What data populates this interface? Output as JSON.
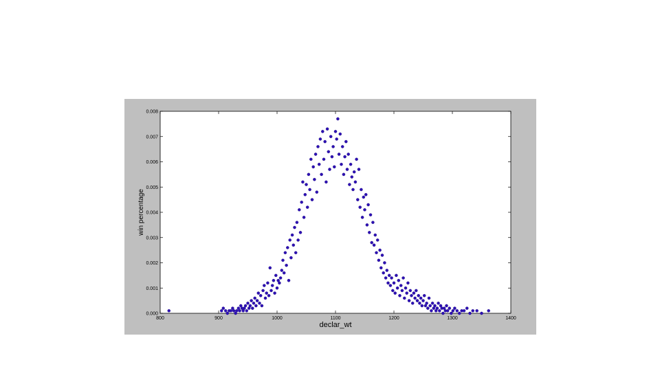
{
  "chart_data": {
    "type": "scatter",
    "title": "",
    "xlabel": "declar_wt",
    "ylabel": "win percentage",
    "xlim": [
      800,
      1400
    ],
    "ylim": [
      0,
      0.008
    ],
    "x_ticks": [
      "800",
      "900",
      "1000",
      "1100",
      "1200",
      "1300",
      "1400"
    ],
    "y_ticks": [
      "0.000",
      "0.001",
      "0.002",
      "0.003",
      "0.004",
      "0.005",
      "0.006",
      "0.007",
      "0.008"
    ],
    "grid": false,
    "legend": "none",
    "marker_color": "#2d10b4",
    "series": [
      {
        "points": [
          [
            815,
            0.0001
          ],
          [
            905,
            0.0001
          ],
          [
            908,
            0.0002
          ],
          [
            912,
            0.0001
          ],
          [
            915,
            0.0
          ],
          [
            918,
            0.0001
          ],
          [
            921,
            0.0001
          ],
          [
            924,
            0.0002
          ],
          [
            926,
            0.0001
          ],
          [
            929,
            0.0
          ],
          [
            931,
            0.0001
          ],
          [
            934,
            0.0002
          ],
          [
            936,
            0.0001
          ],
          [
            938,
            0.0003
          ],
          [
            940,
            0.0002
          ],
          [
            942,
            0.0001
          ],
          [
            944,
            0.0002
          ],
          [
            946,
            0.0003
          ],
          [
            948,
            0.0001
          ],
          [
            950,
            0.0004
          ],
          [
            952,
            0.0002
          ],
          [
            954,
            0.0003
          ],
          [
            956,
            0.0005
          ],
          [
            958,
            0.0002
          ],
          [
            960,
            0.0004
          ],
          [
            962,
            0.0006
          ],
          [
            964,
            0.0003
          ],
          [
            966,
            0.0005
          ],
          [
            968,
            0.0008
          ],
          [
            970,
            0.0004
          ],
          [
            972,
            0.0007
          ],
          [
            974,
            0.0003
          ],
          [
            976,
            0.0009
          ],
          [
            978,
            0.0011
          ],
          [
            980,
            0.0006
          ],
          [
            982,
            0.0008
          ],
          [
            984,
            0.0012
          ],
          [
            986,
            0.0007
          ],
          [
            988,
            0.0018
          ],
          [
            990,
            0.0009
          ],
          [
            992,
            0.0011
          ],
          [
            994,
            0.0013
          ],
          [
            996,
            0.0008
          ],
          [
            998,
            0.0015
          ],
          [
            1000,
            0.001
          ],
          [
            1002,
            0.0013
          ],
          [
            1004,
            0.0012
          ],
          [
            1006,
            0.0014
          ],
          [
            1008,
            0.0017
          ],
          [
            1010,
            0.0021
          ],
          [
            1012,
            0.0016
          ],
          [
            1014,
            0.0024
          ],
          [
            1016,
            0.0019
          ],
          [
            1018,
            0.0026
          ],
          [
            1020,
            0.0013
          ],
          [
            1022,
            0.0029
          ],
          [
            1024,
            0.0022
          ],
          [
            1026,
            0.0031
          ],
          [
            1028,
            0.0027
          ],
          [
            1030,
            0.0034
          ],
          [
            1032,
            0.0024
          ],
          [
            1034,
            0.0036
          ],
          [
            1036,
            0.0029
          ],
          [
            1038,
            0.0041
          ],
          [
            1040,
            0.0032
          ],
          [
            1042,
            0.0044
          ],
          [
            1044,
            0.0052
          ],
          [
            1046,
            0.0038
          ],
          [
            1048,
            0.0047
          ],
          [
            1050,
            0.0051
          ],
          [
            1052,
            0.0042
          ],
          [
            1054,
            0.0055
          ],
          [
            1056,
            0.0049
          ],
          [
            1058,
            0.0061
          ],
          [
            1060,
            0.0045
          ],
          [
            1062,
            0.0058
          ],
          [
            1064,
            0.0053
          ],
          [
            1066,
            0.0063
          ],
          [
            1068,
            0.0048
          ],
          [
            1070,
            0.0066
          ],
          [
            1072,
            0.0059
          ],
          [
            1074,
            0.0069
          ],
          [
            1076,
            0.0055
          ],
          [
            1078,
            0.0072
          ],
          [
            1080,
            0.0061
          ],
          [
            1082,
            0.0068
          ],
          [
            1084,
            0.0052
          ],
          [
            1086,
            0.0073
          ],
          [
            1088,
            0.0064
          ],
          [
            1090,
            0.0057
          ],
          [
            1092,
            0.007
          ],
          [
            1094,
            0.0062
          ],
          [
            1096,
            0.0066
          ],
          [
            1098,
            0.0058
          ],
          [
            1100,
            0.0072
          ],
          [
            1102,
            0.0069
          ],
          [
            1104,
            0.0077
          ],
          [
            1106,
            0.0063
          ],
          [
            1108,
            0.0071
          ],
          [
            1110,
            0.0059
          ],
          [
            1112,
            0.0066
          ],
          [
            1114,
            0.0055
          ],
          [
            1116,
            0.0062
          ],
          [
            1118,
            0.0068
          ],
          [
            1120,
            0.0057
          ],
          [
            1122,
            0.0063
          ],
          [
            1124,
            0.0051
          ],
          [
            1126,
            0.0059
          ],
          [
            1128,
            0.0054
          ],
          [
            1130,
            0.0049
          ],
          [
            1132,
            0.0056
          ],
          [
            1134,
            0.0052
          ],
          [
            1136,
            0.0061
          ],
          [
            1138,
            0.0045
          ],
          [
            1140,
            0.0057
          ],
          [
            1142,
            0.0042
          ],
          [
            1144,
            0.0049
          ],
          [
            1146,
            0.0038
          ],
          [
            1148,
            0.0046
          ],
          [
            1150,
            0.0041
          ],
          [
            1152,
            0.0047
          ],
          [
            1154,
            0.0035
          ],
          [
            1156,
            0.0043
          ],
          [
            1158,
            0.0032
          ],
          [
            1160,
            0.0039
          ],
          [
            1162,
            0.0028
          ],
          [
            1164,
            0.0036
          ],
          [
            1166,
            0.0027
          ],
          [
            1168,
            0.0031
          ],
          [
            1170,
            0.0024
          ],
          [
            1172,
            0.0029
          ],
          [
            1174,
            0.0021
          ],
          [
            1176,
            0.0025
          ],
          [
            1178,
            0.0018
          ],
          [
            1180,
            0.0023
          ],
          [
            1182,
            0.0016
          ],
          [
            1184,
            0.002
          ],
          [
            1186,
            0.0014
          ],
          [
            1188,
            0.0017
          ],
          [
            1190,
            0.0012
          ],
          [
            1192,
            0.0015
          ],
          [
            1194,
            0.0011
          ],
          [
            1196,
            0.0014
          ],
          [
            1198,
            0.0009
          ],
          [
            1200,
            0.0012
          ],
          [
            1202,
            0.0008
          ],
          [
            1204,
            0.0015
          ],
          [
            1206,
            0.001
          ],
          [
            1208,
            0.0013
          ],
          [
            1210,
            0.0007
          ],
          [
            1212,
            0.0011
          ],
          [
            1214,
            0.0009
          ],
          [
            1216,
            0.0014
          ],
          [
            1218,
            0.0006
          ],
          [
            1220,
            0.001
          ],
          [
            1222,
            0.0008
          ],
          [
            1224,
            0.0012
          ],
          [
            1226,
            0.0005
          ],
          [
            1228,
            0.0009
          ],
          [
            1230,
            0.0007
          ],
          [
            1232,
            0.0004
          ],
          [
            1234,
            0.0008
          ],
          [
            1236,
            0.0006
          ],
          [
            1238,
            0.0009
          ],
          [
            1240,
            0.0005
          ],
          [
            1242,
            0.0007
          ],
          [
            1244,
            0.0004
          ],
          [
            1246,
            0.0006
          ],
          [
            1248,
            0.0003
          ],
          [
            1250,
            0.0005
          ],
          [
            1252,
            0.0007
          ],
          [
            1254,
            0.0003
          ],
          [
            1256,
            0.0004
          ],
          [
            1258,
            0.0002
          ],
          [
            1260,
            0.0006
          ],
          [
            1262,
            0.0003
          ],
          [
            1264,
            0.0001
          ],
          [
            1266,
            0.0004
          ],
          [
            1268,
            0.0002
          ],
          [
            1270,
            0.0003
          ],
          [
            1272,
            0.0001
          ],
          [
            1274,
            0.0002
          ],
          [
            1276,
            0.0004
          ],
          [
            1278,
            0.0001
          ],
          [
            1280,
            0.0003
          ],
          [
            1282,
            0.0002
          ],
          [
            1284,
            0.0
          ],
          [
            1286,
            0.0002
          ],
          [
            1288,
            0.0001
          ],
          [
            1290,
            0.0003
          ],
          [
            1292,
            0.0001
          ],
          [
            1295,
            0.0002
          ],
          [
            1298,
            0.0
          ],
          [
            1301,
            0.0001
          ],
          [
            1304,
            0.0002
          ],
          [
            1308,
            0.0001
          ],
          [
            1312,
            0.0
          ],
          [
            1316,
            0.0001
          ],
          [
            1320,
            0.0001
          ],
          [
            1325,
            0.0002
          ],
          [
            1330,
            0.0
          ],
          [
            1335,
            0.0001
          ],
          [
            1342,
            0.0001
          ],
          [
            1350,
            0.0
          ],
          [
            1362,
            0.0001
          ]
        ]
      }
    ]
  }
}
